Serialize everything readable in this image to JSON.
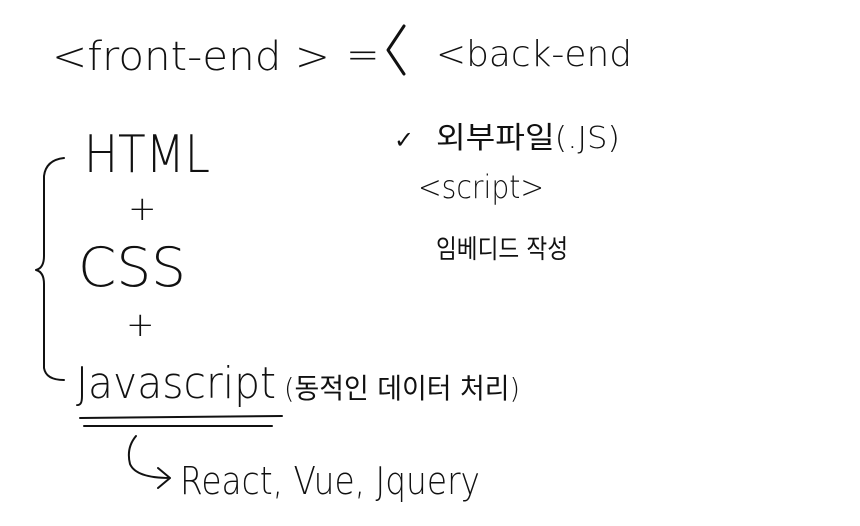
{
  "top_line": {
    "front_end": "<front-end >",
    "equals": "=",
    "bracket": "<",
    "back_end": "<back-end"
  },
  "stack": {
    "html": "HTML",
    "plus_1": "+",
    "css": "CSS",
    "plus_2": "+",
    "javascript": "Javascript",
    "javascript_note": "(동적인 데이터 처리)",
    "frameworks": "React, Vue, Jquery"
  },
  "notes": {
    "check": "✓",
    "external_file": "외부파일(.JS)",
    "script_tag": "<script>",
    "embedded": "임베디드 작성"
  }
}
